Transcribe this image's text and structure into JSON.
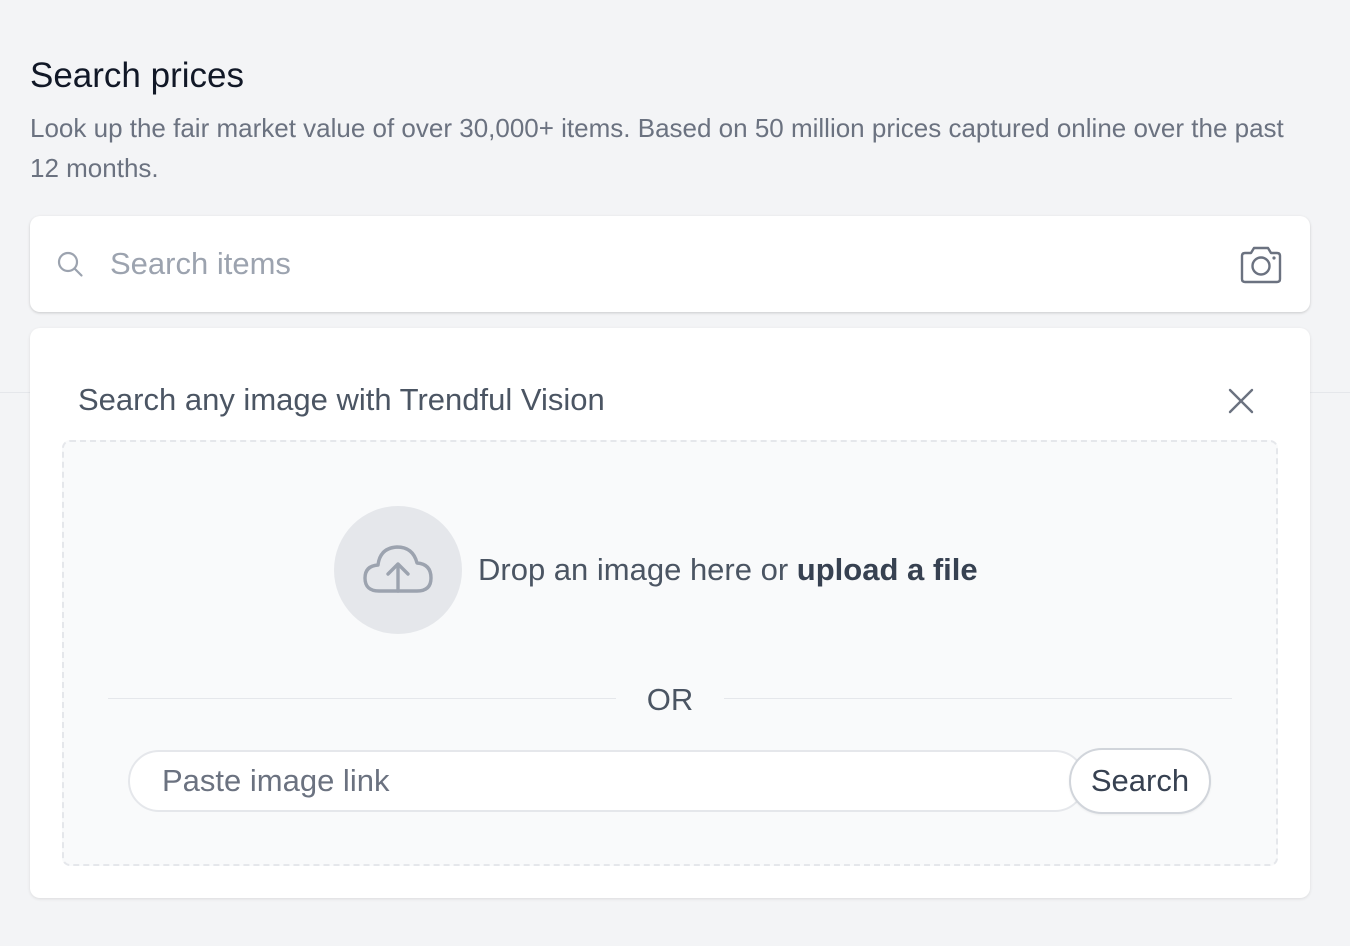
{
  "header": {
    "title": "Search prices",
    "subtitle": "Look up the fair market value of over 30,000+ items. Based on 50 million prices captured online over the past 12 months."
  },
  "search": {
    "placeholder": "Search items",
    "value": ""
  },
  "vision_panel": {
    "title": "Search any image with Trendful Vision",
    "drop_text": "Drop an image here or ",
    "upload_link": "upload a file",
    "or_label": "OR",
    "link_placeholder": "Paste image link",
    "link_value": "",
    "search_button_label": "Search"
  },
  "icons": {
    "search": "search-icon",
    "camera": "camera-icon",
    "close": "close-icon",
    "upload": "cloud-upload-icon"
  },
  "colors": {
    "background": "#f3f4f6",
    "card": "#ffffff",
    "title_text": "#111827",
    "muted_text": "#6b7280",
    "icon_gray": "#9ca3af",
    "upload_circle": "#e5e7eb",
    "dropzone_bg": "#f9fafb"
  }
}
